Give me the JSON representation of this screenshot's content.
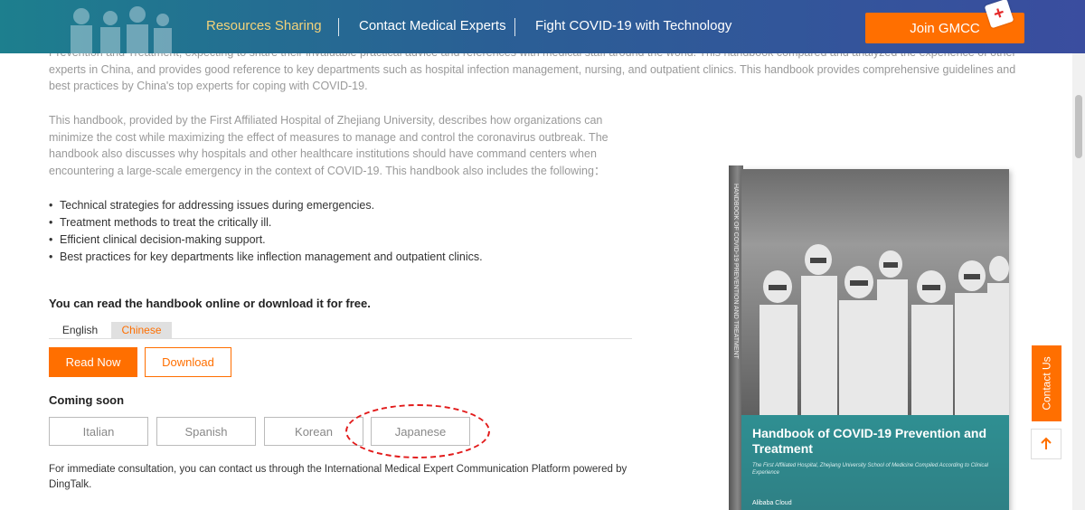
{
  "header": {
    "nav": [
      {
        "label": "Resources Sharing",
        "active": true
      },
      {
        "label": "Contact Medical Experts",
        "active": false
      },
      {
        "label": "Fight COVID-19 with Technology",
        "active": false
      }
    ],
    "join_label": "Join GMCC",
    "badge_glyph": "+"
  },
  "content": {
    "para1": "Prevention and Treatment, expecting to share their invaluable practical advice and references with medical staff around the world. This handbook compared and analyzed the experience of other experts in China, and provides good reference to key departments such as hospital infection management, nursing, and outpatient clinics. This handbook provides comprehensive guidelines and best practices by China's top experts for coping with COVID-19.",
    "para2": "This handbook, provided by the First Affiliated Hospital of Zhejiang University, describes how organizations can minimize the cost while maximizing the effect of measures to manage and control the coronavirus outbreak. The handbook also discusses why hospitals and other healthcare institutions should have command centers when encountering a large-scale emergency in the context of COVID-19. This handbook also includes the following：",
    "bullets": [
      "Technical strategies for addressing issues during emergencies.",
      "Treatment methods to treat the critically ill.",
      "Efficient clinical decision-making support.",
      "Best practices for key departments like inflection management and outpatient clinics."
    ],
    "read_intro": "You can read the handbook online or download it for free.",
    "lang_tabs": [
      "English",
      "Chinese"
    ],
    "read_now": "Read Now",
    "download": "Download",
    "coming_soon": "Coming soon",
    "coming_langs": [
      "Italian",
      "Spanish",
      "Korean",
      "Japanese"
    ],
    "consult": "For immediate consultation, you can contact us through the International Medical Expert Communication Platform powered by DingTalk."
  },
  "book": {
    "title": "Handbook of COVID-19 Prevention and Treatment",
    "subtitle": "The First Affiliated Hospital, Zhejiang University School of Medicine Compiled According to Clinical Experience",
    "spine": "HANDBOOK OF COVID-19 PREVENTION AND TREATMENT",
    "logos": [
      "Alibaba Cloud"
    ]
  },
  "side": {
    "contact_us": "Contact Us",
    "to_top_icon": "arrow-up-icon"
  },
  "colors": {
    "accent": "#ff6f00",
    "nav_active": "#f3d27a",
    "ellipse": "#e21b1b"
  }
}
